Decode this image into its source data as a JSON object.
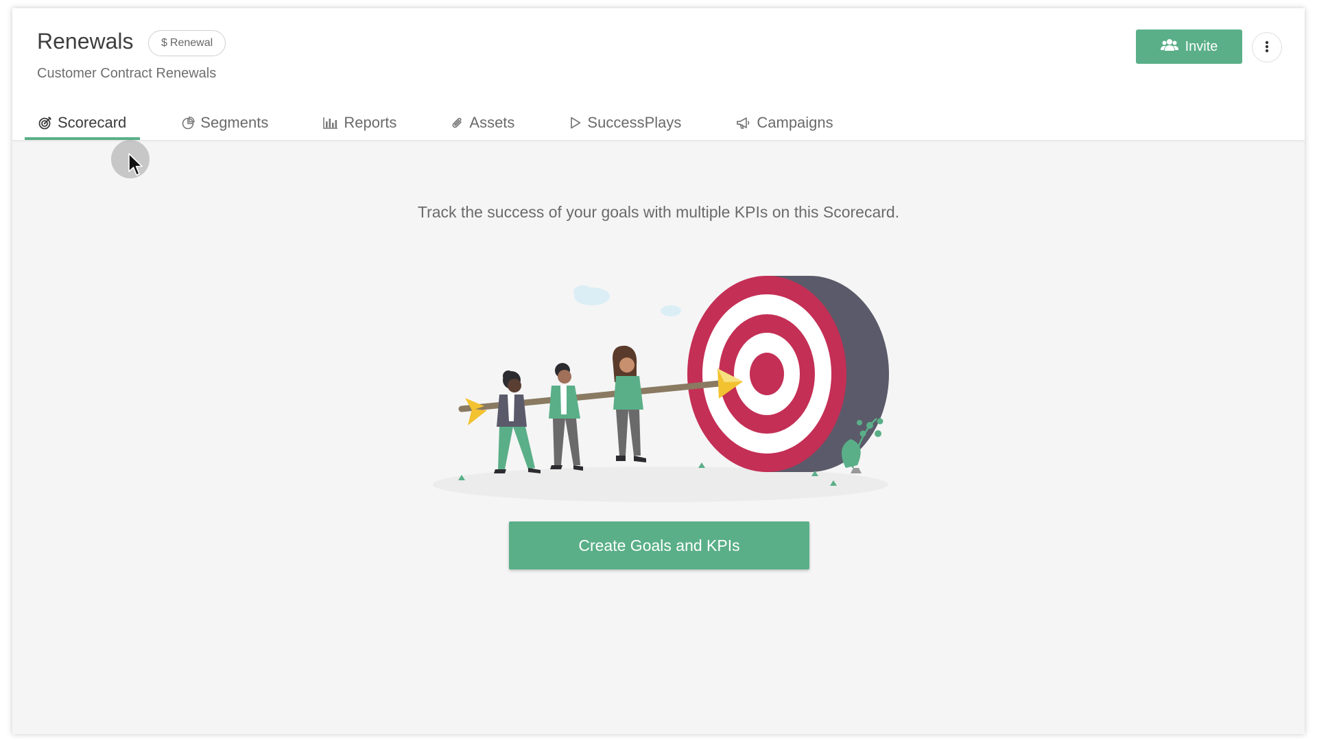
{
  "header": {
    "title": "Renewals",
    "badge": {
      "symbol": "$",
      "label": "Renewal"
    },
    "subtitle": "Customer Contract Renewals",
    "invite_label": "Invite",
    "invite_icon": "users-icon",
    "more_icon": "vertical-ellipsis-icon"
  },
  "tabs": [
    {
      "label": "Scorecard",
      "icon": "target-icon",
      "active": true
    },
    {
      "label": "Segments",
      "icon": "pie-chart-icon",
      "active": false
    },
    {
      "label": "Reports",
      "icon": "bar-chart-icon",
      "active": false
    },
    {
      "label": "Assets",
      "icon": "paperclip-icon",
      "active": false
    },
    {
      "label": "SuccessPlays",
      "icon": "play-icon",
      "active": false
    },
    {
      "label": "Campaigns",
      "icon": "megaphone-icon",
      "active": false
    }
  ],
  "main": {
    "empty_message": "Track the success of your goals with multiple KPIs on this Scorecard.",
    "cta_label": "Create Goals and KPIs"
  },
  "colors": {
    "accent": "#5aaf88",
    "target_red": "#c42f55",
    "target_side": "#5b5a6a",
    "arrow_yellow": "#f2c230"
  }
}
